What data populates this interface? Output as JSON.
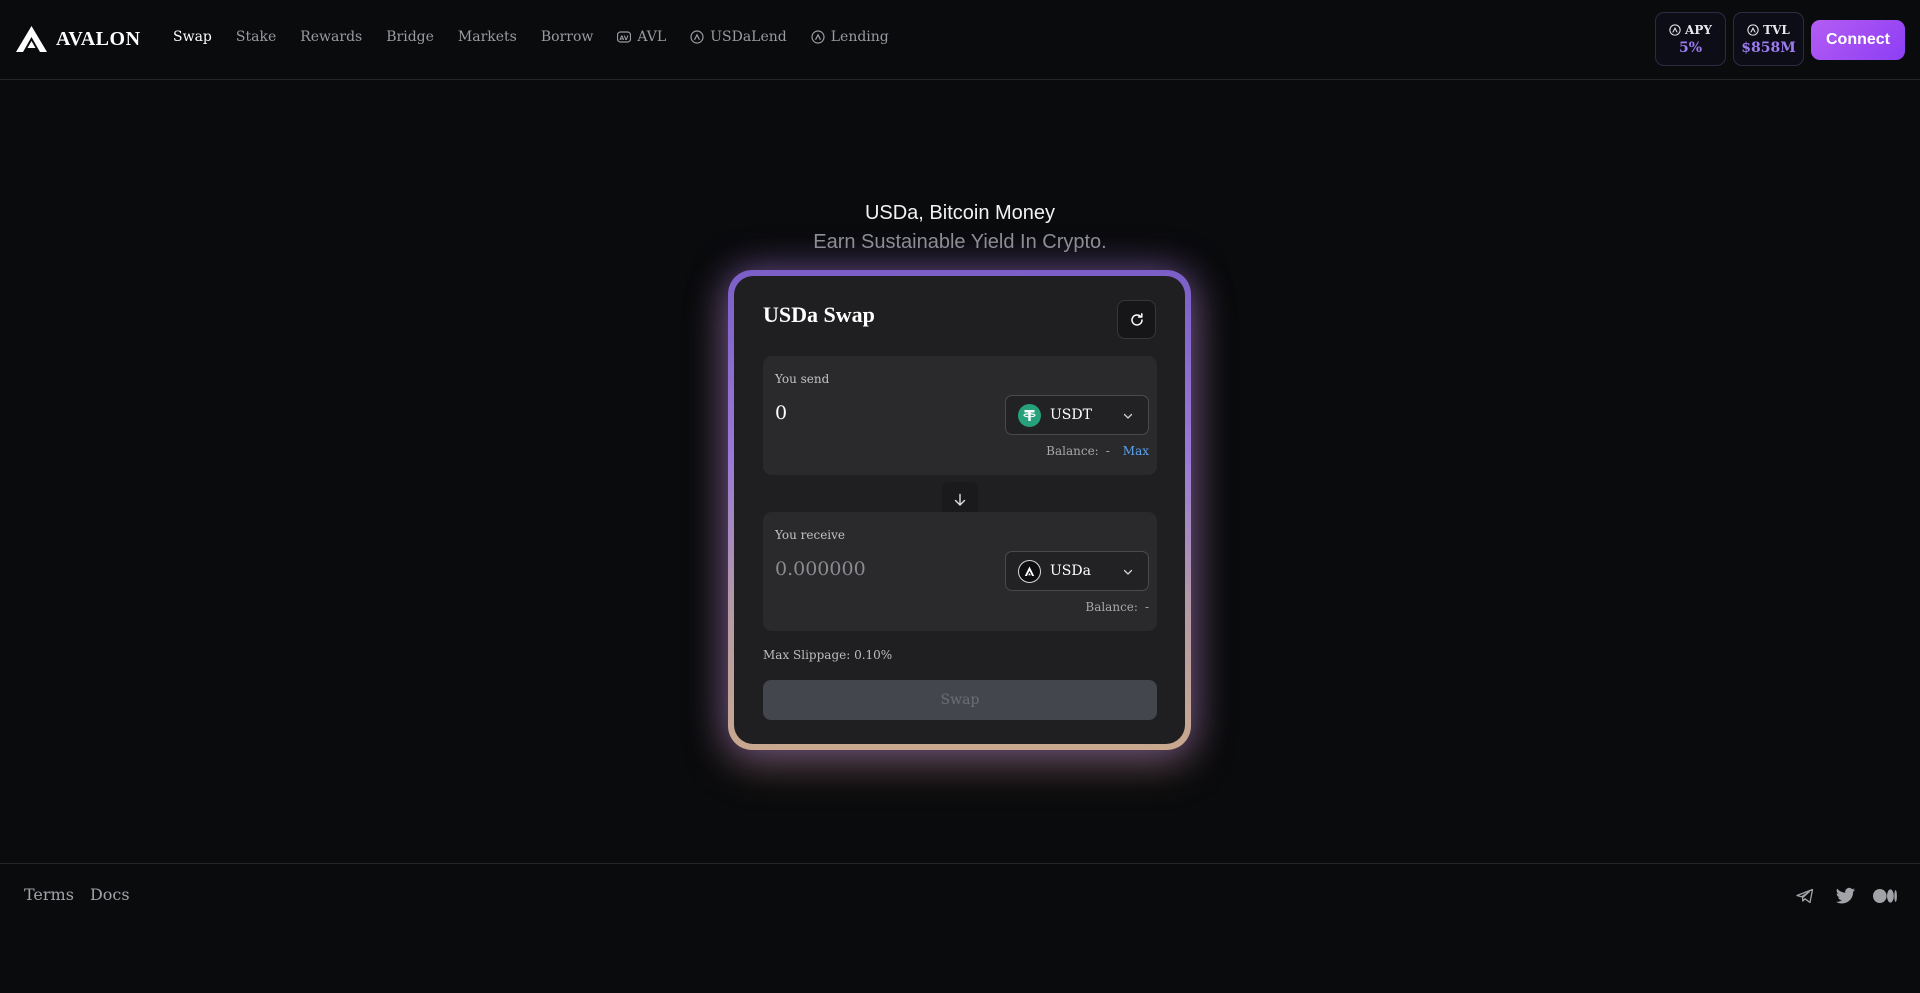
{
  "brand": {
    "name": "AVALON"
  },
  "nav": [
    {
      "label": "Swap",
      "active": true,
      "icon": ""
    },
    {
      "label": "Stake",
      "icon": ""
    },
    {
      "label": "Rewards",
      "icon": ""
    },
    {
      "label": "Bridge",
      "icon": ""
    },
    {
      "label": "Markets",
      "icon": ""
    },
    {
      "label": "Borrow",
      "icon": ""
    },
    {
      "label": "AVL",
      "icon": "avl-token-icon"
    },
    {
      "label": "USDaLend",
      "icon": "avalon-icon"
    },
    {
      "label": "Lending",
      "icon": "avalon-icon"
    }
  ],
  "stats": {
    "apy": {
      "label": "APY",
      "value": "5%"
    },
    "tvl": {
      "label": "TVL",
      "value": "$858M"
    }
  },
  "connect_label": "Connect",
  "hero": {
    "title": "USDa, Bitcoin Money",
    "subtitle": "Earn Sustainable Yield In Crypto."
  },
  "swap": {
    "title": "USDa Swap",
    "send": {
      "label": "You send",
      "amount": "0",
      "token": "USDT",
      "balance_label": "Balance:",
      "balance_value": "-",
      "max_label": "Max"
    },
    "receive": {
      "label": "You receive",
      "placeholder": "0.000000",
      "token": "USDa",
      "balance_label": "Balance:",
      "balance_value": "-"
    },
    "slippage": "Max Slippage: 0.10%",
    "button_label": "Swap"
  },
  "footer": {
    "links": [
      "Terms",
      "Docs"
    ],
    "socials": [
      "telegram-icon",
      "twitter-icon",
      "medium-icon"
    ]
  },
  "colors": {
    "background": "#0a0b0d",
    "accent": "#9b4df4",
    "stat_value": "#9d7cf2",
    "max_link": "#5aa3f0",
    "usdt": "#26a17b"
  }
}
